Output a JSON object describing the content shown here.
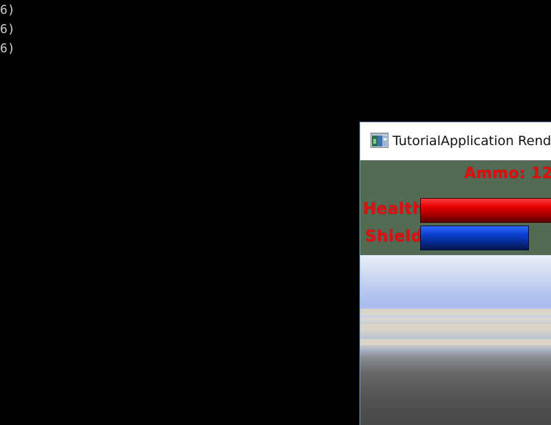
{
  "console": {
    "lines": [
      "6)",
      "6)",
      "6)"
    ]
  },
  "window": {
    "title": "TutorialApplication Rend",
    "icon": "ogre-app-icon"
  },
  "hud": {
    "ammo_label": "Ammo:",
    "ammo_value": "12",
    "health_label": "Health",
    "shield_label": "Shield",
    "health_level_fraction": 1.0,
    "shield_level_fraction": 0.75,
    "text_color": "#e01010",
    "panel_color": "#536b55",
    "health_color": "#e40000",
    "shield_color": "#0a3fd0"
  }
}
